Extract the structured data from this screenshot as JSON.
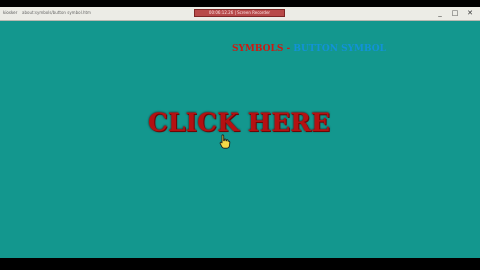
{
  "browser": {
    "app_name": "kiosker",
    "address": "about:symbols/button symbol.htm",
    "recording_badge": "00:06:12.26 | Screen Recorder",
    "minimize_glyph": "_",
    "maximize_glyph": "□",
    "close_glyph": "✕"
  },
  "page": {
    "background_color": "#13978e",
    "header": {
      "symbols_label": "SYMBOLS",
      "separator": " - ",
      "link_label": "BUTTON SYMBOL"
    },
    "main_link_label": "CLICK HERE",
    "cursor_icon": "hand-pointer-icon"
  }
}
